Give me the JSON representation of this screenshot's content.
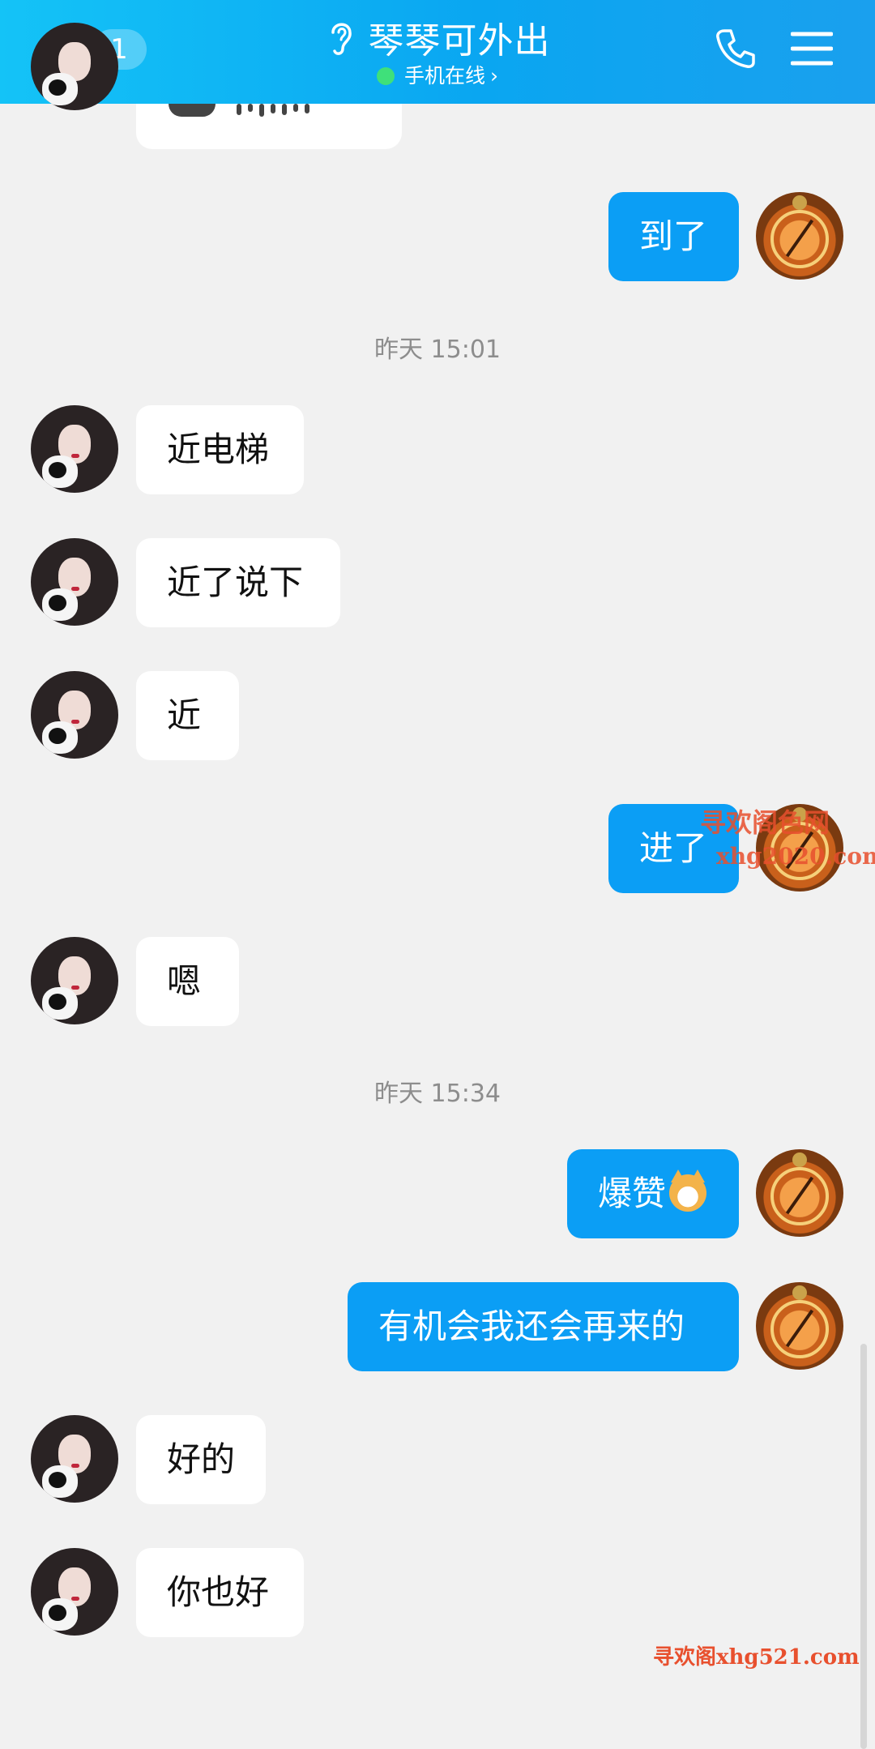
{
  "header": {
    "unread_count": "1",
    "title": "琴琴可外出",
    "status": "手机在线",
    "status_chevron": "›"
  },
  "messages": [
    {
      "side": "out",
      "text": "到了"
    },
    {
      "type": "time",
      "text": "昨天 15:01"
    },
    {
      "side": "in",
      "text": "近电梯"
    },
    {
      "side": "in",
      "text": "近了说下"
    },
    {
      "side": "in",
      "text": "近"
    },
    {
      "side": "out",
      "text": "进了"
    },
    {
      "side": "in",
      "text": "嗯"
    },
    {
      "type": "time",
      "text": "昨天 15:34"
    },
    {
      "side": "out",
      "text": "爆赞",
      "emoji": "shiba-emoji"
    },
    {
      "side": "out",
      "text": "有机会我还会再来的"
    },
    {
      "side": "in",
      "text": "好的"
    },
    {
      "side": "in",
      "text": "你也好"
    }
  ],
  "watermarks": {
    "top_line1": "寻欢阁色网",
    "top_line2": "xhg2020.com",
    "bottom": "寻欢阁xhg521.com"
  },
  "colors": {
    "header_start": "#14c3f7",
    "header_end": "#1aa0ee",
    "outgoing_bubble": "#0b9ef5",
    "incoming_bubble": "#ffffff",
    "background": "#f1f1f1",
    "online_dot": "#3fe07a"
  },
  "icons": [
    "back-icon",
    "ear-icon",
    "phone-icon",
    "menu-icon",
    "voice-play-icon",
    "shiba-emoji"
  ]
}
